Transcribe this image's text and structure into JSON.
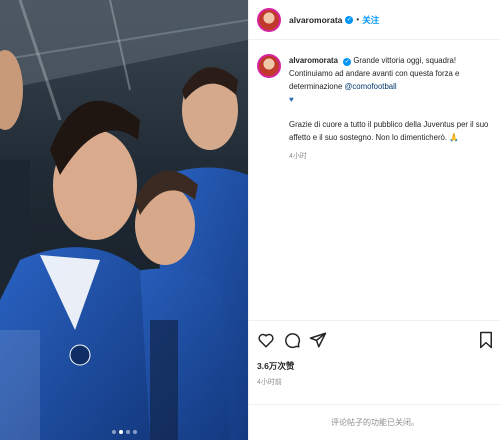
{
  "post": {
    "username": "alvaromorata",
    "follow_label": "关注",
    "separator": "•",
    "caption_line1": "Grande vittoria oggi, squadra! Continuiamo ad andare avanti con questa forza e determinazione",
    "mention": "@comofootball",
    "caption_emoji": "♥",
    "caption_line2": "Grazie di cuore a tutto il pubblico della Juventus per il suo affetto e il suo sostegno. Non lo dimenticherò. 🙏",
    "caption_time": "4小时",
    "likes": "3.6万次赞",
    "post_time": "4小时前",
    "comments_disabled": "评论帖子的功能已关闭。"
  },
  "icons": {
    "like": "heart-icon",
    "comment": "comment-icon",
    "share": "share-icon",
    "save": "bookmark-icon",
    "verified": "verified-badge-icon"
  },
  "colors": {
    "accent": "#0095f6",
    "mention": "#00376b",
    "muted": "#8e8e8e",
    "jersey": "#1e4fa3"
  },
  "carousel": {
    "total": 4,
    "active": 2
  }
}
